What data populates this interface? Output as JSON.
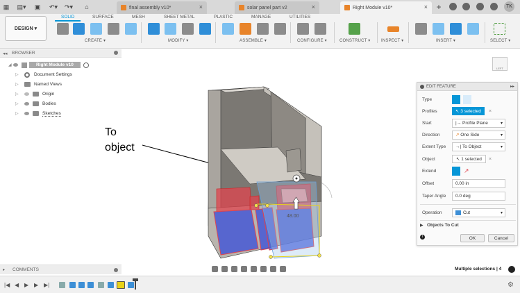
{
  "tabbar": {
    "tabs": [
      {
        "label": "final assembly v10*"
      },
      {
        "label": "solar panel part v2"
      },
      {
        "label": "Right Module v10*"
      }
    ],
    "user_initials": "TK"
  },
  "ribbon": {
    "tabs": [
      "SOLID",
      "SURFACE",
      "MESH",
      "SHEET METAL",
      "PLASTIC",
      "MANAGE",
      "UTILITIES"
    ],
    "active_tab": "SOLID",
    "workspace_label": "DESIGN",
    "groups": [
      "CREATE",
      "MODIFY",
      "ASSEMBLE",
      "CONFIGURE",
      "CONSTRUCT",
      "INSPECT",
      "INSERT",
      "SELECT"
    ]
  },
  "browser": {
    "title": "BROWSER",
    "root": "Right Module v10",
    "items": [
      "Document Settings",
      "Named Views",
      "Origin",
      "Bodies",
      "Sketches"
    ]
  },
  "annotation": {
    "line1": "To",
    "line2": "object"
  },
  "viewport": {
    "dimension_label": "48.00",
    "viewcube_label": "LEFT"
  },
  "edit_feature": {
    "title": "EDIT FEATURE",
    "rows": {
      "type_label": "Type",
      "profiles_label": "Profiles",
      "profiles_value": "3 selected",
      "start_label": "Start",
      "start_value": "Profile Plane",
      "direction_label": "Direction",
      "direction_value": "One Side",
      "extent_label": "Extent Type",
      "extent_value": "To Object",
      "object_label": "Object",
      "object_value": "1 selected",
      "extend_label": "Extend",
      "offset_label": "Offset",
      "offset_value": "0.00 in",
      "taper_label": "Taper Angle",
      "taper_value": "0.0 deg",
      "operation_label": "Operation",
      "operation_value": "Cut",
      "objects_to_cut": "Objects To Cut"
    },
    "ok_label": "OK",
    "cancel_label": "Cancel"
  },
  "comments": {
    "label": "COMMENTS"
  },
  "status": {
    "text": "Multiple selections | 4"
  },
  "colors": {
    "accent": "#0696d7",
    "cut_red": "#e0444e",
    "cut_blue": "#3b4fd9",
    "selection_yellow": "#e8d21a"
  }
}
